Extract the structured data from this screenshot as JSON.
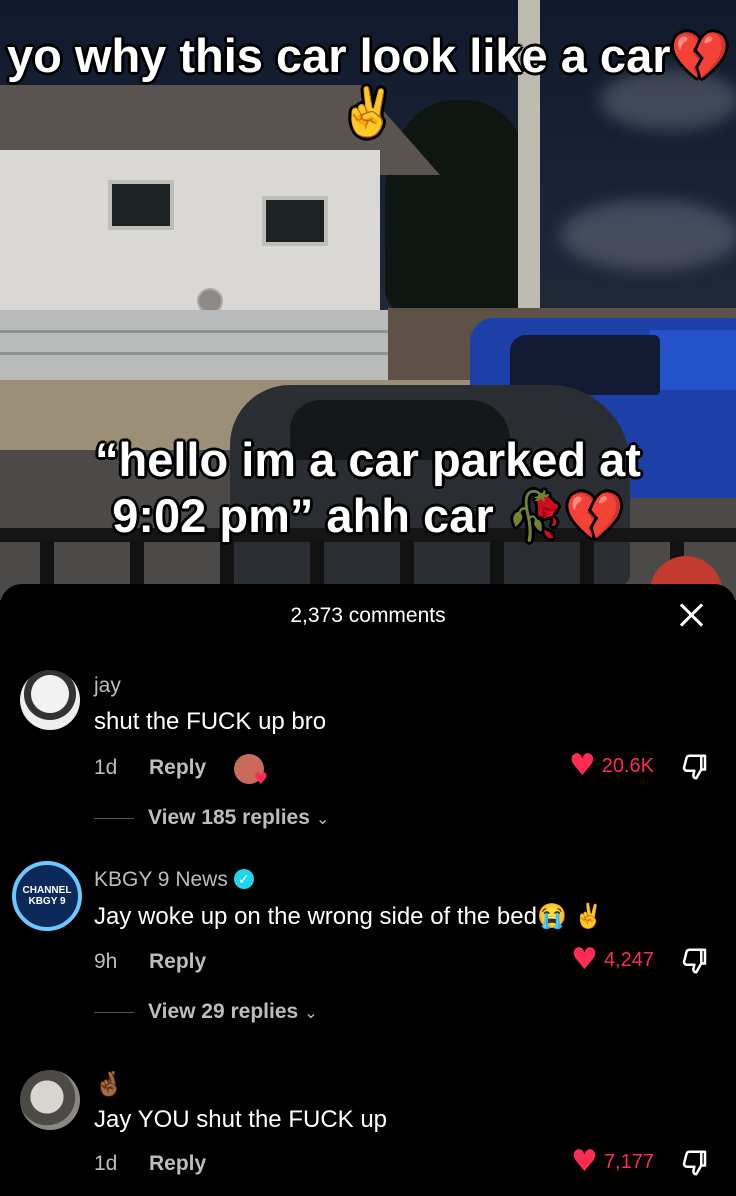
{
  "video": {
    "caption_top": "yo why this car look like a car💔✌️",
    "caption_bottom": "“hello im a car parked at 9:02 pm” ahh car 🥀💔"
  },
  "comments_sheet": {
    "title": "2,373 comments",
    "comments": [
      {
        "username": "jay",
        "text": "shut the FUCK up bro",
        "time": "1d",
        "reply_label": "Reply",
        "likes": "20.6K",
        "liked_by_creator": true,
        "view_replies": "View 185 replies"
      },
      {
        "username": "KBGY 9 News",
        "verified": true,
        "avatar_logo": "CHANNEL KBGY 9",
        "text": "Jay woke up on the wrong side of the bed😭 ✌️",
        "time": "9h",
        "reply_label": "Reply",
        "likes": "4,247",
        "view_replies": "View 29 replies"
      },
      {
        "username": "🤞🏾",
        "text": "Jay YOU shut the FUCK up",
        "time": "1d",
        "reply_label": "Reply",
        "likes": "7,177"
      }
    ]
  },
  "colors": {
    "like_red": "#fe2c55",
    "verified_blue": "#20d5ec",
    "sheet_bg": "#000000"
  }
}
